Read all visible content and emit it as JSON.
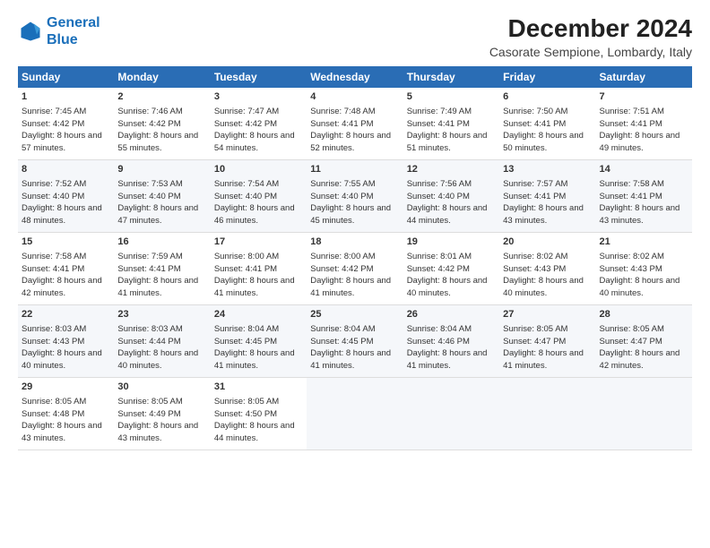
{
  "logo": {
    "line1": "General",
    "line2": "Blue"
  },
  "title": "December 2024",
  "subtitle": "Casorate Sempione, Lombardy, Italy",
  "days_of_week": [
    "Sunday",
    "Monday",
    "Tuesday",
    "Wednesday",
    "Thursday",
    "Friday",
    "Saturday"
  ],
  "weeks": [
    [
      {
        "day": 1,
        "sunrise": "7:45 AM",
        "sunset": "4:42 PM",
        "daylight": "8 hours and 57 minutes."
      },
      {
        "day": 2,
        "sunrise": "7:46 AM",
        "sunset": "4:42 PM",
        "daylight": "8 hours and 55 minutes."
      },
      {
        "day": 3,
        "sunrise": "7:47 AM",
        "sunset": "4:42 PM",
        "daylight": "8 hours and 54 minutes."
      },
      {
        "day": 4,
        "sunrise": "7:48 AM",
        "sunset": "4:41 PM",
        "daylight": "8 hours and 52 minutes."
      },
      {
        "day": 5,
        "sunrise": "7:49 AM",
        "sunset": "4:41 PM",
        "daylight": "8 hours and 51 minutes."
      },
      {
        "day": 6,
        "sunrise": "7:50 AM",
        "sunset": "4:41 PM",
        "daylight": "8 hours and 50 minutes."
      },
      {
        "day": 7,
        "sunrise": "7:51 AM",
        "sunset": "4:41 PM",
        "daylight": "8 hours and 49 minutes."
      }
    ],
    [
      {
        "day": 8,
        "sunrise": "7:52 AM",
        "sunset": "4:40 PM",
        "daylight": "8 hours and 48 minutes."
      },
      {
        "day": 9,
        "sunrise": "7:53 AM",
        "sunset": "4:40 PM",
        "daylight": "8 hours and 47 minutes."
      },
      {
        "day": 10,
        "sunrise": "7:54 AM",
        "sunset": "4:40 PM",
        "daylight": "8 hours and 46 minutes."
      },
      {
        "day": 11,
        "sunrise": "7:55 AM",
        "sunset": "4:40 PM",
        "daylight": "8 hours and 45 minutes."
      },
      {
        "day": 12,
        "sunrise": "7:56 AM",
        "sunset": "4:40 PM",
        "daylight": "8 hours and 44 minutes."
      },
      {
        "day": 13,
        "sunrise": "7:57 AM",
        "sunset": "4:41 PM",
        "daylight": "8 hours and 43 minutes."
      },
      {
        "day": 14,
        "sunrise": "7:58 AM",
        "sunset": "4:41 PM",
        "daylight": "8 hours and 43 minutes."
      }
    ],
    [
      {
        "day": 15,
        "sunrise": "7:58 AM",
        "sunset": "4:41 PM",
        "daylight": "8 hours and 42 minutes."
      },
      {
        "day": 16,
        "sunrise": "7:59 AM",
        "sunset": "4:41 PM",
        "daylight": "8 hours and 41 minutes."
      },
      {
        "day": 17,
        "sunrise": "8:00 AM",
        "sunset": "4:41 PM",
        "daylight": "8 hours and 41 minutes."
      },
      {
        "day": 18,
        "sunrise": "8:00 AM",
        "sunset": "4:42 PM",
        "daylight": "8 hours and 41 minutes."
      },
      {
        "day": 19,
        "sunrise": "8:01 AM",
        "sunset": "4:42 PM",
        "daylight": "8 hours and 40 minutes."
      },
      {
        "day": 20,
        "sunrise": "8:02 AM",
        "sunset": "4:43 PM",
        "daylight": "8 hours and 40 minutes."
      },
      {
        "day": 21,
        "sunrise": "8:02 AM",
        "sunset": "4:43 PM",
        "daylight": "8 hours and 40 minutes."
      }
    ],
    [
      {
        "day": 22,
        "sunrise": "8:03 AM",
        "sunset": "4:43 PM",
        "daylight": "8 hours and 40 minutes."
      },
      {
        "day": 23,
        "sunrise": "8:03 AM",
        "sunset": "4:44 PM",
        "daylight": "8 hours and 40 minutes."
      },
      {
        "day": 24,
        "sunrise": "8:04 AM",
        "sunset": "4:45 PM",
        "daylight": "8 hours and 41 minutes."
      },
      {
        "day": 25,
        "sunrise": "8:04 AM",
        "sunset": "4:45 PM",
        "daylight": "8 hours and 41 minutes."
      },
      {
        "day": 26,
        "sunrise": "8:04 AM",
        "sunset": "4:46 PM",
        "daylight": "8 hours and 41 minutes."
      },
      {
        "day": 27,
        "sunrise": "8:05 AM",
        "sunset": "4:47 PM",
        "daylight": "8 hours and 41 minutes."
      },
      {
        "day": 28,
        "sunrise": "8:05 AM",
        "sunset": "4:47 PM",
        "daylight": "8 hours and 42 minutes."
      }
    ],
    [
      {
        "day": 29,
        "sunrise": "8:05 AM",
        "sunset": "4:48 PM",
        "daylight": "8 hours and 43 minutes."
      },
      {
        "day": 30,
        "sunrise": "8:05 AM",
        "sunset": "4:49 PM",
        "daylight": "8 hours and 43 minutes."
      },
      {
        "day": 31,
        "sunrise": "8:05 AM",
        "sunset": "4:50 PM",
        "daylight": "8 hours and 44 minutes."
      },
      null,
      null,
      null,
      null
    ]
  ]
}
